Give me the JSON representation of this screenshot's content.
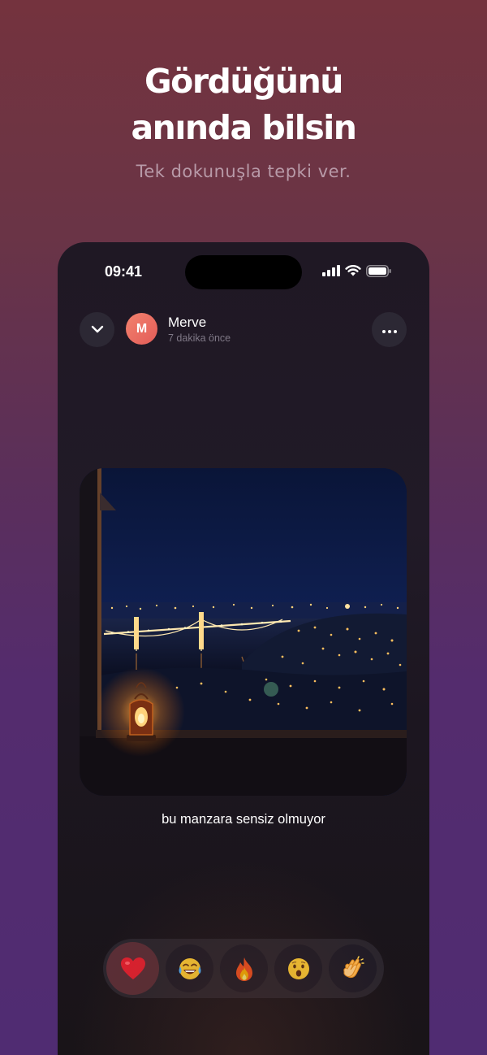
{
  "hero": {
    "title_line1": "Gördüğünü",
    "title_line2": "anında bilsin",
    "subtitle": "Tek dokunuşla tepki ver."
  },
  "status_bar": {
    "time": "09:41",
    "icons": [
      "cellular-signal-icon",
      "wifi-icon",
      "battery-icon"
    ]
  },
  "header": {
    "back_icon": "chevron-down-icon",
    "avatar_initial": "M",
    "user_name": "Merve",
    "timestamp": "7 dakika önce",
    "more_icon": "more-horizontal-icon"
  },
  "post": {
    "image": "night-bosphorus-bridge-lantern-photo",
    "caption": "bu manzara sensiz olmuyor"
  },
  "reactions": [
    {
      "name": "heart",
      "icon": "red-heart-icon",
      "selected": true
    },
    {
      "name": "laugh",
      "icon": "tears-of-joy-icon",
      "selected": false
    },
    {
      "name": "fire",
      "icon": "fire-icon",
      "selected": false
    },
    {
      "name": "wow",
      "icon": "surprised-face-icon",
      "selected": false
    },
    {
      "name": "clap",
      "icon": "clapping-hands-icon",
      "selected": false
    }
  ],
  "colors": {
    "background_top": "#74333e",
    "background_bottom": "#502c72",
    "phone_surface": "#1f1824",
    "avatar": "#e96a5f",
    "selected_reaction": "#5a2e36",
    "heart": "#e0202e"
  }
}
